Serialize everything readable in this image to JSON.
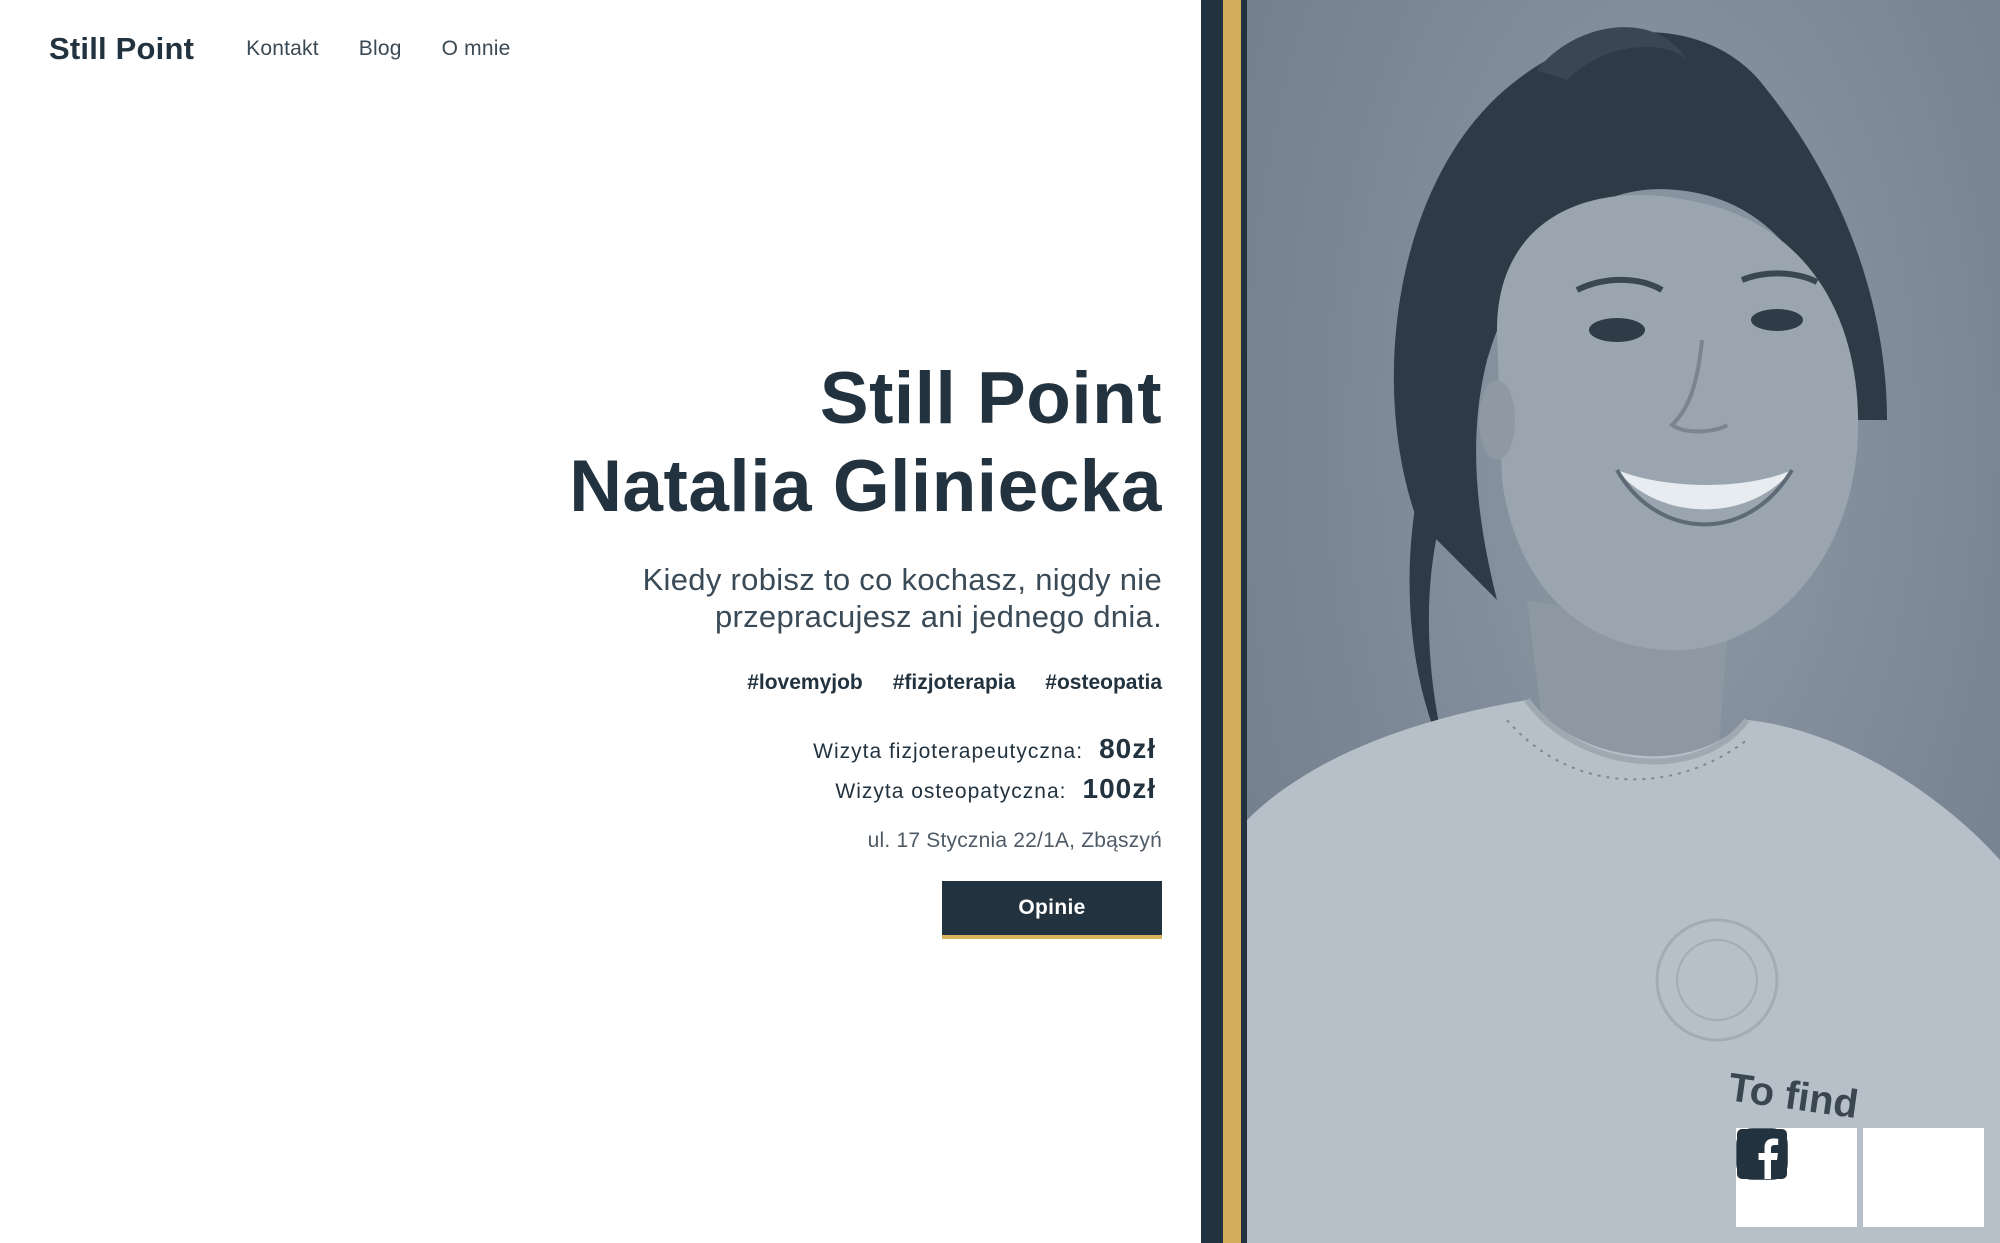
{
  "header": {
    "brand": "Still Point",
    "nav": [
      {
        "label": "Kontakt"
      },
      {
        "label": "Blog"
      },
      {
        "label": "O mnie"
      }
    ]
  },
  "hero": {
    "title_line1": "Still Point",
    "title_line2": "Natalia Gliniecka",
    "tagline_line1": "Kiedy robisz to co kochasz, nigdy nie",
    "tagline_line2": "przepracujesz ani jednego dnia.",
    "hashtags": [
      "#lovemyjob",
      "#fizjoterapia",
      "#osteopatia"
    ],
    "prices": [
      {
        "label": "Wizyta fizjoterapeutyczna:",
        "value": "80zł"
      },
      {
        "label": "Wizyta osteopatyczna:",
        "value": "100zł"
      }
    ],
    "address": "ul. 17 Stycznia 22/1A, Zbąszyń",
    "cta_label": "Opinie"
  },
  "photo": {
    "shirt_text": "To find"
  },
  "social": {
    "icons": [
      "instagram-icon",
      "facebook-icon"
    ]
  },
  "colors": {
    "navy": "#22333f",
    "gold": "#d4ad5b",
    "photo_tint": "#7b8794"
  }
}
